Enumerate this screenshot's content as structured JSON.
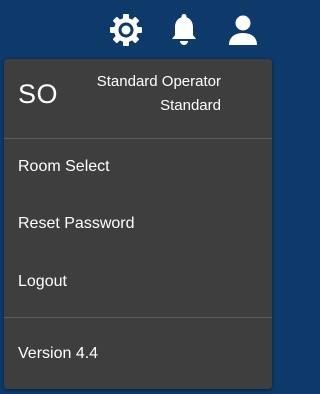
{
  "header": {
    "icons": [
      "settings-icon",
      "notification-bell-icon",
      "user-icon"
    ],
    "icon_color": "#ffffff",
    "background": "#0d3a6a"
  },
  "menu": {
    "background": "#3e3e3e",
    "profile": {
      "initials": "SO",
      "name": "Standard Operator",
      "role": "Standard"
    },
    "items": [
      {
        "label": "Room Select"
      },
      {
        "label": "Reset Password"
      },
      {
        "label": "Logout"
      }
    ],
    "version": "Version 4.4"
  }
}
